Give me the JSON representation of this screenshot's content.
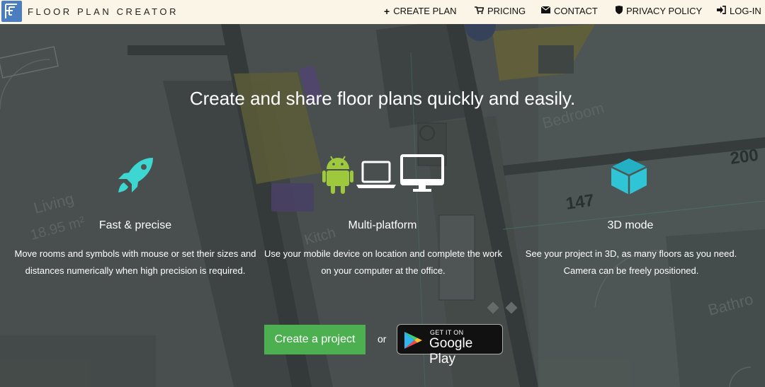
{
  "header": {
    "brand": "FLOOR PLAN CREATOR",
    "nav": [
      {
        "label": "CREATE PLAN",
        "icon": "plus-icon"
      },
      {
        "label": "PRICING",
        "icon": "cart-icon"
      },
      {
        "label": "CONTACT",
        "icon": "envelope-icon"
      },
      {
        "label": "PRIVACY POLICY",
        "icon": "shield-icon"
      },
      {
        "label": "LOG-IN",
        "icon": "sign-in-icon"
      }
    ]
  },
  "hero": {
    "title": "Create and share floor plans quickly and easily."
  },
  "features": [
    {
      "title": "Fast & precise",
      "text": "Move rooms and symbols with mouse or set their sizes and distances numerically when high precision is required.",
      "icon": "rocket-icon"
    },
    {
      "title": "Multi-platform",
      "text": "Use your mobile device on location and complete the work on your computer at the office.",
      "icon": "devices-icon"
    },
    {
      "title": "3D mode",
      "text": "See your project in 3D, as many floors as you need. Camera can be freely positioned.",
      "icon": "cube-icon"
    }
  ],
  "cta": {
    "create_label": "Create a project",
    "or_label": "or",
    "gplay_small": "GET IT ON",
    "gplay_big": "Google Play"
  },
  "background_labels": {
    "living": "Living",
    "living_area": "18.95 m²",
    "kitchen": "Kitch",
    "bedroom": "Bedroom",
    "bathroom": "Bathro",
    "dim1": "147",
    "dim2": "200"
  },
  "colors": {
    "header_bg": "#fbf5e7",
    "accent_green": "#4caf50",
    "icon_teal": "#3dd6d0",
    "android_green": "#9fc93c"
  }
}
